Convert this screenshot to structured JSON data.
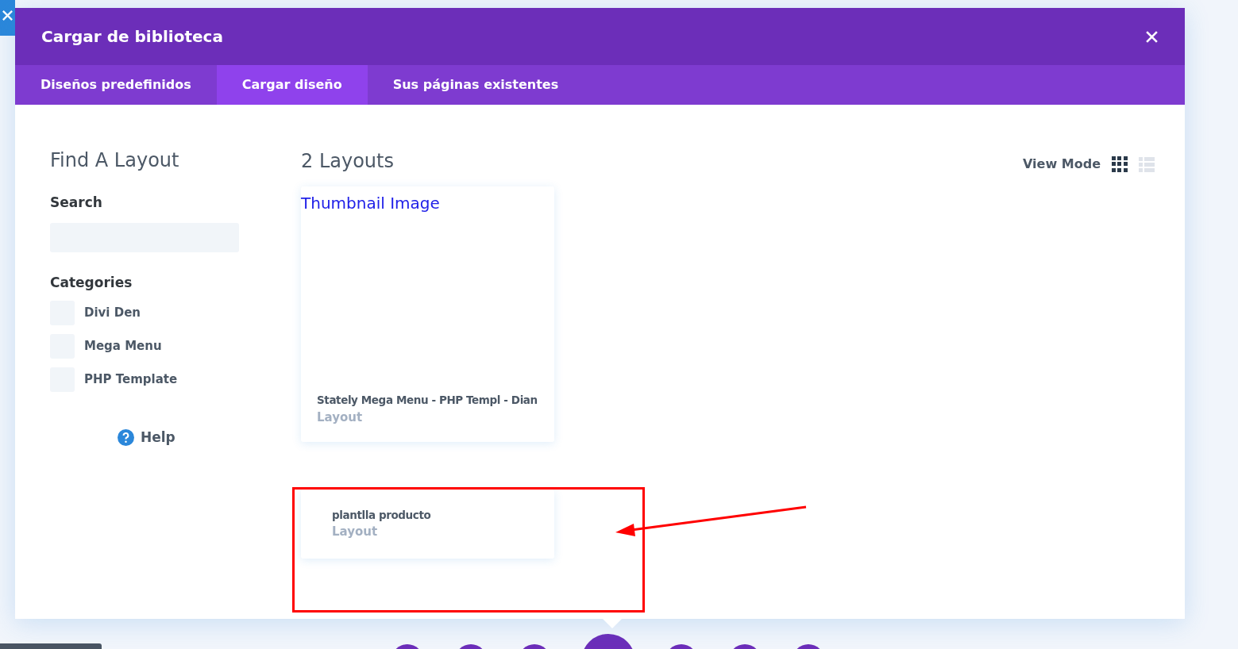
{
  "modal": {
    "title": "Cargar de biblioteca"
  },
  "tabs": [
    {
      "label": "Diseños predefinidos",
      "selected": false
    },
    {
      "label": "Cargar diseño",
      "selected": true
    },
    {
      "label": "Sus páginas existentes",
      "selected": false
    }
  ],
  "sidebar": {
    "heading": "Find A Layout",
    "search_label": "Search",
    "categories_label": "Categories",
    "categories": [
      {
        "label": "Divi Den",
        "checked": false
      },
      {
        "label": "Mega Menu",
        "checked": false
      },
      {
        "label": "PHP Template",
        "checked": false
      }
    ],
    "help": "Help"
  },
  "main": {
    "heading": "2 Layouts",
    "view_mode_label": "View Mode",
    "view_modes": [
      {
        "kind": "grid",
        "selected": true
      },
      {
        "kind": "list",
        "selected": false
      }
    ],
    "layouts": [
      {
        "thumbnail_alt": "Thumbnail Image",
        "title": "Stately Mega Menu - PHP Templ - Dian",
        "type": "Layout"
      },
      {
        "title": "plantlla producto",
        "type": "Layout"
      }
    ]
  }
}
